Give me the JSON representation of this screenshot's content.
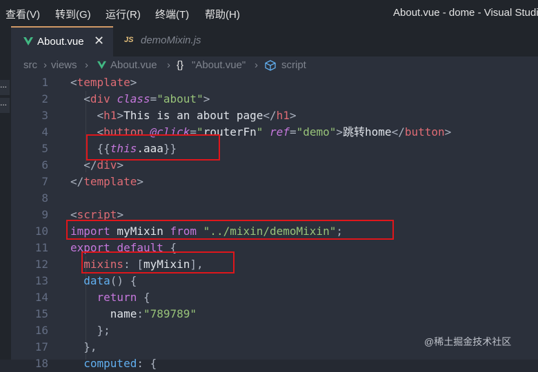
{
  "menubar": {
    "items": [
      "查看(V)",
      "转到(G)",
      "运行(R)",
      "终端(T)",
      "帮助(H)"
    ],
    "window_title": "About.vue - dome - Visual Studi"
  },
  "tabs": [
    {
      "label": "About.vue",
      "icon": "vue-logo-icon",
      "active": true,
      "close": "✕"
    },
    {
      "label": "demoMixin.js",
      "icon": "js-file-icon",
      "icon_text": "JS",
      "active": false
    }
  ],
  "breadcrumb": {
    "items": [
      "src",
      "views",
      "About.vue",
      "\"About.vue\"",
      "script"
    ],
    "sep": "›",
    "braces": "{}"
  },
  "side_stubs": [
    "...",
    "..."
  ],
  "editor": {
    "line_numbers": [
      "1",
      "2",
      "3",
      "4",
      "5",
      "6",
      "7",
      "8",
      "9",
      "10",
      "11",
      "12",
      "13",
      "14",
      "15",
      "16",
      "17",
      "18"
    ],
    "lines": [
      [
        [
          "t-pun",
          "<"
        ],
        [
          "t-tag",
          "template"
        ],
        [
          "t-pun",
          ">"
        ]
      ],
      [
        [
          "t-pun",
          "  <"
        ],
        [
          "t-tag",
          "div"
        ],
        [
          "t-pun",
          " "
        ],
        [
          "t-attr",
          "class"
        ],
        [
          "t-pun",
          "="
        ],
        [
          "t-str",
          "\"about\""
        ],
        [
          "t-pun",
          ">"
        ]
      ],
      [
        [
          "t-pun",
          "    <"
        ],
        [
          "t-tag",
          "h1"
        ],
        [
          "t-pun",
          ">"
        ],
        [
          "t-txt",
          "This is an about page"
        ],
        [
          "t-pun",
          "</"
        ],
        [
          "t-tag",
          "h1"
        ],
        [
          "t-pun",
          ">"
        ]
      ],
      [
        [
          "t-pun",
          "    <"
        ],
        [
          "t-tag",
          "button"
        ],
        [
          "t-pun",
          " "
        ],
        [
          "t-attr",
          "@click"
        ],
        [
          "t-pun",
          "="
        ],
        [
          "t-str",
          "\""
        ],
        [
          "t-txt",
          "routerFn"
        ],
        [
          "t-str",
          "\""
        ],
        [
          "t-pun",
          " "
        ],
        [
          "t-attr",
          "ref"
        ],
        [
          "t-pun",
          "="
        ],
        [
          "t-str",
          "\"demo\""
        ],
        [
          "t-pun",
          ">"
        ],
        [
          "t-txt",
          "跳转home"
        ],
        [
          "t-pun",
          "</"
        ],
        [
          "t-tag",
          "button"
        ],
        [
          "t-pun",
          ">"
        ]
      ],
      [
        [
          "t-pun",
          "    {{"
        ],
        [
          "t-this",
          "this"
        ],
        [
          "t-txt",
          ".aaa"
        ],
        [
          "t-pun",
          "}}"
        ]
      ],
      [
        [
          "t-pun",
          "  </"
        ],
        [
          "t-tag",
          "div"
        ],
        [
          "t-pun",
          ">"
        ]
      ],
      [
        [
          "t-pun",
          "</"
        ],
        [
          "t-tag",
          "template"
        ],
        [
          "t-pun",
          ">"
        ]
      ],
      [
        [
          "t-pun",
          ""
        ]
      ],
      [
        [
          "t-pun",
          "<"
        ],
        [
          "t-tag",
          "script"
        ],
        [
          "t-pun",
          ">"
        ]
      ],
      [
        [
          "t-kw",
          "import"
        ],
        [
          "t-txt",
          " myMixin "
        ],
        [
          "t-kw",
          "from"
        ],
        [
          "t-txt",
          " "
        ],
        [
          "t-str",
          "\"../mixin/demoMixin\""
        ],
        [
          "t-pun",
          ";"
        ]
      ],
      [
        [
          "t-kw",
          "export"
        ],
        [
          "t-txt",
          " "
        ],
        [
          "t-kw",
          "default"
        ],
        [
          "t-txt",
          " "
        ],
        [
          "t-pun",
          "{"
        ]
      ],
      [
        [
          "t-txt",
          "  "
        ],
        [
          "t-prop",
          "mixins"
        ],
        [
          "t-pun",
          ": ["
        ],
        [
          "t-txt",
          "myMixin"
        ],
        [
          "t-pun",
          "],"
        ]
      ],
      [
        [
          "t-txt",
          "  "
        ],
        [
          "t-fn",
          "data"
        ],
        [
          "t-pun",
          "() {"
        ]
      ],
      [
        [
          "t-txt",
          "    "
        ],
        [
          "t-kw",
          "return"
        ],
        [
          "t-pun",
          " {"
        ]
      ],
      [
        [
          "t-txt",
          "      "
        ],
        [
          "t-txt",
          "name"
        ],
        [
          "t-pun",
          ":"
        ],
        [
          "t-str",
          "\"789789\""
        ]
      ],
      [
        [
          "t-pun",
          "    };"
        ]
      ],
      [
        [
          "t-pun",
          "  },"
        ]
      ],
      [
        [
          "t-txt",
          "  "
        ],
        [
          "t-fn",
          "computed"
        ],
        [
          "t-pun",
          ": {"
        ]
      ]
    ]
  },
  "watermark": "@稀土掘金技术社区",
  "colors": {
    "highlight_box": "#e0161b",
    "tab_active_border": "#d19a66",
    "vue_green": "#42b883"
  }
}
